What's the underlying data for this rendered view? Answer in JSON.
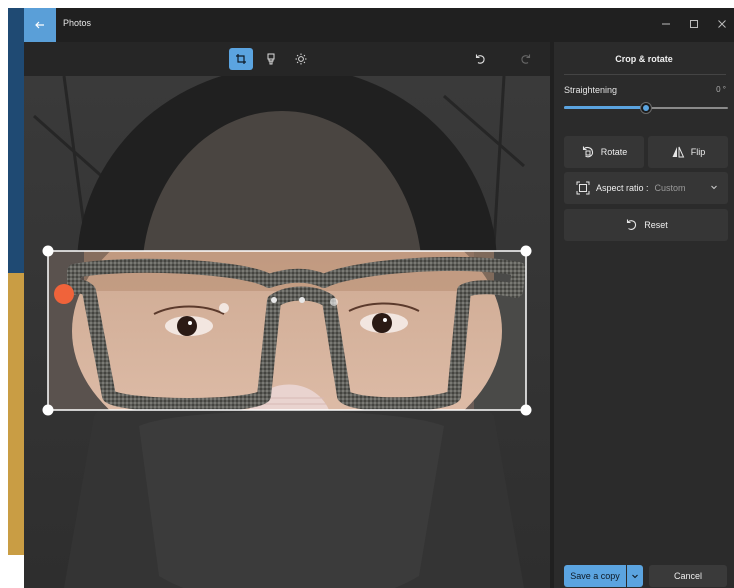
{
  "window": {
    "title": "Photos"
  },
  "panel": {
    "title": "Crop & rotate",
    "straightening": {
      "label": "Straightening",
      "value_text": "0 °",
      "level_fraction": 0.5
    },
    "rotate_label": "Rotate",
    "flip_label": "Flip",
    "aspect_label": "Aspect ratio :",
    "aspect_value": "Custom",
    "reset_label": "Reset",
    "save_label": "Save a copy",
    "cancel_label": "Cancel"
  },
  "icons": {
    "back": "arrow-left-icon",
    "crop": "crop-icon",
    "markup": "markup-icon",
    "adjust": "brightness-icon",
    "undo": "undo-icon",
    "redo": "redo-icon",
    "rotate": "rotate-icon",
    "flip": "flip-icon",
    "aspect": "aspect-ratio-icon",
    "reset": "reset-icon"
  },
  "colors": {
    "accent": "#5ba4e0",
    "panel_bg": "#2b2b2b",
    "window_bg": "#202020",
    "marker": "#f0633a"
  }
}
